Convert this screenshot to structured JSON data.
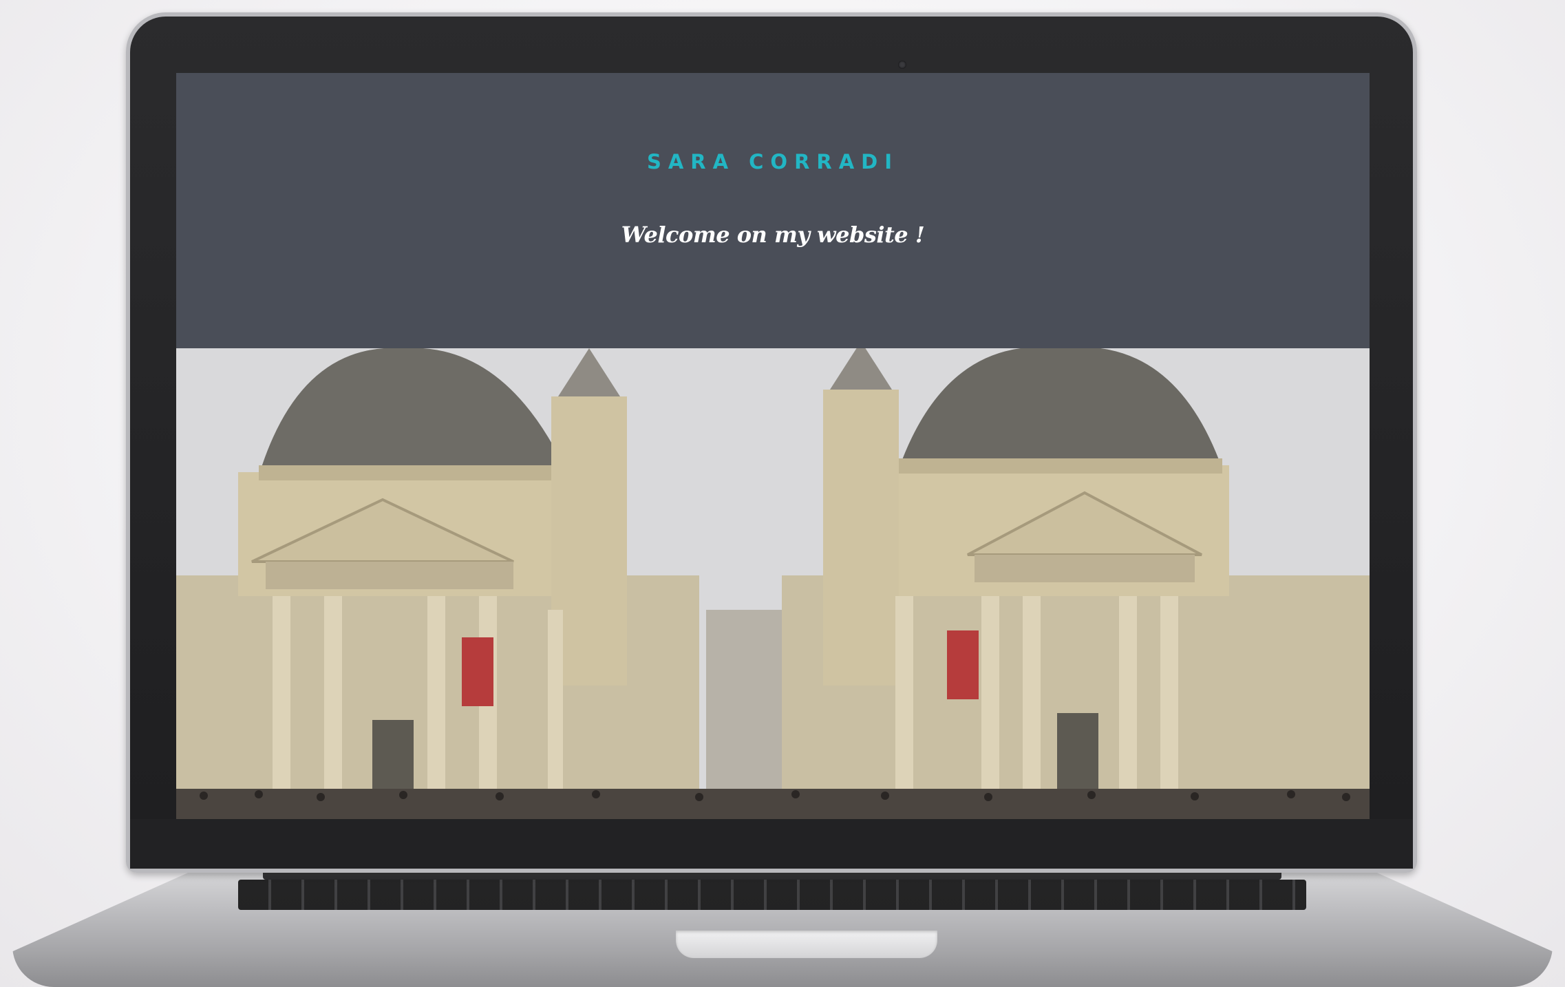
{
  "site": {
    "title": "SARA CORRADI",
    "welcome": "Welcome on my website !"
  },
  "colors": {
    "header_background": "#4a4e58",
    "title_accent": "#22b6c4",
    "welcome_text": "#ffffff"
  },
  "hero_image": {
    "subject": "twin-domed churches on a city square"
  }
}
